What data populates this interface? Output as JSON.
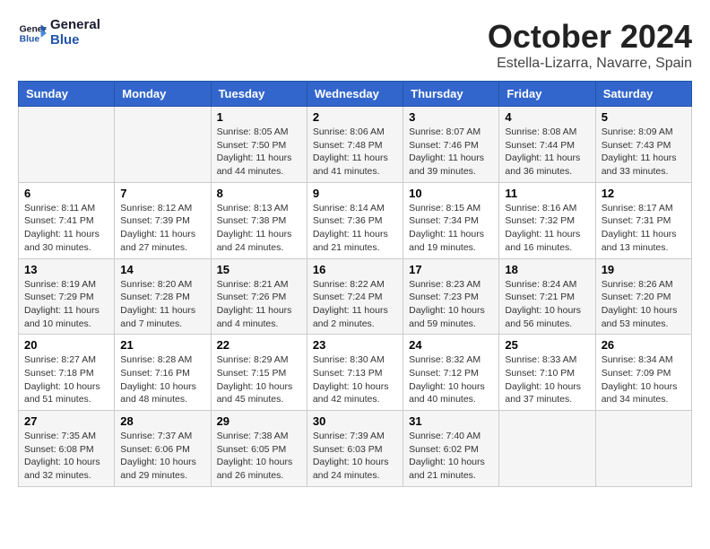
{
  "header": {
    "logo_general": "General",
    "logo_blue": "Blue",
    "month_title": "October 2024",
    "location": "Estella-Lizarra, Navarre, Spain"
  },
  "weekdays": [
    "Sunday",
    "Monday",
    "Tuesday",
    "Wednesday",
    "Thursday",
    "Friday",
    "Saturday"
  ],
  "weeks": [
    [
      {
        "day": "",
        "info": ""
      },
      {
        "day": "",
        "info": ""
      },
      {
        "day": "1",
        "info": "Sunrise: 8:05 AM\nSunset: 7:50 PM\nDaylight: 11 hours and 44 minutes."
      },
      {
        "day": "2",
        "info": "Sunrise: 8:06 AM\nSunset: 7:48 PM\nDaylight: 11 hours and 41 minutes."
      },
      {
        "day": "3",
        "info": "Sunrise: 8:07 AM\nSunset: 7:46 PM\nDaylight: 11 hours and 39 minutes."
      },
      {
        "day": "4",
        "info": "Sunrise: 8:08 AM\nSunset: 7:44 PM\nDaylight: 11 hours and 36 minutes."
      },
      {
        "day": "5",
        "info": "Sunrise: 8:09 AM\nSunset: 7:43 PM\nDaylight: 11 hours and 33 minutes."
      }
    ],
    [
      {
        "day": "6",
        "info": "Sunrise: 8:11 AM\nSunset: 7:41 PM\nDaylight: 11 hours and 30 minutes."
      },
      {
        "day": "7",
        "info": "Sunrise: 8:12 AM\nSunset: 7:39 PM\nDaylight: 11 hours and 27 minutes."
      },
      {
        "day": "8",
        "info": "Sunrise: 8:13 AM\nSunset: 7:38 PM\nDaylight: 11 hours and 24 minutes."
      },
      {
        "day": "9",
        "info": "Sunrise: 8:14 AM\nSunset: 7:36 PM\nDaylight: 11 hours and 21 minutes."
      },
      {
        "day": "10",
        "info": "Sunrise: 8:15 AM\nSunset: 7:34 PM\nDaylight: 11 hours and 19 minutes."
      },
      {
        "day": "11",
        "info": "Sunrise: 8:16 AM\nSunset: 7:32 PM\nDaylight: 11 hours and 16 minutes."
      },
      {
        "day": "12",
        "info": "Sunrise: 8:17 AM\nSunset: 7:31 PM\nDaylight: 11 hours and 13 minutes."
      }
    ],
    [
      {
        "day": "13",
        "info": "Sunrise: 8:19 AM\nSunset: 7:29 PM\nDaylight: 11 hours and 10 minutes."
      },
      {
        "day": "14",
        "info": "Sunrise: 8:20 AM\nSunset: 7:28 PM\nDaylight: 11 hours and 7 minutes."
      },
      {
        "day": "15",
        "info": "Sunrise: 8:21 AM\nSunset: 7:26 PM\nDaylight: 11 hours and 4 minutes."
      },
      {
        "day": "16",
        "info": "Sunrise: 8:22 AM\nSunset: 7:24 PM\nDaylight: 11 hours and 2 minutes."
      },
      {
        "day": "17",
        "info": "Sunrise: 8:23 AM\nSunset: 7:23 PM\nDaylight: 10 hours and 59 minutes."
      },
      {
        "day": "18",
        "info": "Sunrise: 8:24 AM\nSunset: 7:21 PM\nDaylight: 10 hours and 56 minutes."
      },
      {
        "day": "19",
        "info": "Sunrise: 8:26 AM\nSunset: 7:20 PM\nDaylight: 10 hours and 53 minutes."
      }
    ],
    [
      {
        "day": "20",
        "info": "Sunrise: 8:27 AM\nSunset: 7:18 PM\nDaylight: 10 hours and 51 minutes."
      },
      {
        "day": "21",
        "info": "Sunrise: 8:28 AM\nSunset: 7:16 PM\nDaylight: 10 hours and 48 minutes."
      },
      {
        "day": "22",
        "info": "Sunrise: 8:29 AM\nSunset: 7:15 PM\nDaylight: 10 hours and 45 minutes."
      },
      {
        "day": "23",
        "info": "Sunrise: 8:30 AM\nSunset: 7:13 PM\nDaylight: 10 hours and 42 minutes."
      },
      {
        "day": "24",
        "info": "Sunrise: 8:32 AM\nSunset: 7:12 PM\nDaylight: 10 hours and 40 minutes."
      },
      {
        "day": "25",
        "info": "Sunrise: 8:33 AM\nSunset: 7:10 PM\nDaylight: 10 hours and 37 minutes."
      },
      {
        "day": "26",
        "info": "Sunrise: 8:34 AM\nSunset: 7:09 PM\nDaylight: 10 hours and 34 minutes."
      }
    ],
    [
      {
        "day": "27",
        "info": "Sunrise: 7:35 AM\nSunset: 6:08 PM\nDaylight: 10 hours and 32 minutes."
      },
      {
        "day": "28",
        "info": "Sunrise: 7:37 AM\nSunset: 6:06 PM\nDaylight: 10 hours and 29 minutes."
      },
      {
        "day": "29",
        "info": "Sunrise: 7:38 AM\nSunset: 6:05 PM\nDaylight: 10 hours and 26 minutes."
      },
      {
        "day": "30",
        "info": "Sunrise: 7:39 AM\nSunset: 6:03 PM\nDaylight: 10 hours and 24 minutes."
      },
      {
        "day": "31",
        "info": "Sunrise: 7:40 AM\nSunset: 6:02 PM\nDaylight: 10 hours and 21 minutes."
      },
      {
        "day": "",
        "info": ""
      },
      {
        "day": "",
        "info": ""
      }
    ]
  ]
}
